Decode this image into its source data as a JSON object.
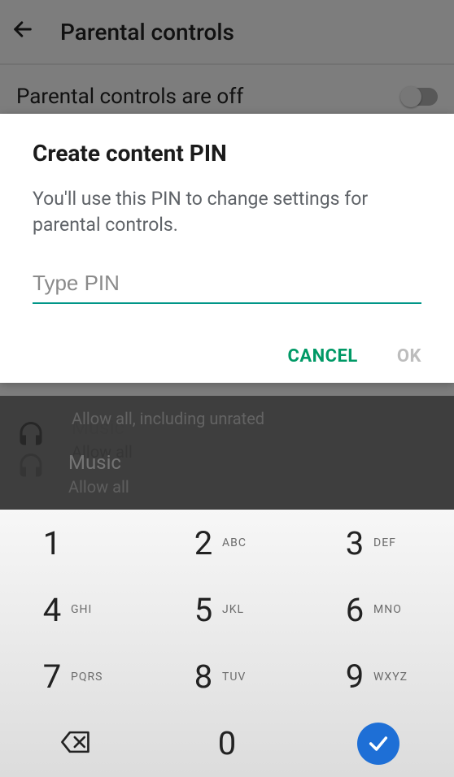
{
  "header": {
    "title": "Parental controls"
  },
  "page": {
    "status_text": "Parental controls are off",
    "items": [
      {
        "primary": "Allow all, including unrated",
        "secondary": ""
      },
      {
        "primary": "Music",
        "secondary": "Allow all"
      }
    ]
  },
  "dialog": {
    "title": "Create content PIN",
    "description": "You'll use this PIN to change settings for parental controls.",
    "input_placeholder": "Type PIN",
    "input_value": "",
    "cancel_label": "CANCEL",
    "ok_label": "OK"
  },
  "keypad": {
    "keys": [
      {
        "digit": "1",
        "letters": ""
      },
      {
        "digit": "2",
        "letters": "ABC"
      },
      {
        "digit": "3",
        "letters": "DEF"
      },
      {
        "digit": "4",
        "letters": "GHI"
      },
      {
        "digit": "5",
        "letters": "JKL"
      },
      {
        "digit": "6",
        "letters": "MNO"
      },
      {
        "digit": "7",
        "letters": "PQRS"
      },
      {
        "digit": "8",
        "letters": "TUV"
      },
      {
        "digit": "9",
        "letters": "WXYZ"
      }
    ],
    "zero": "0"
  }
}
